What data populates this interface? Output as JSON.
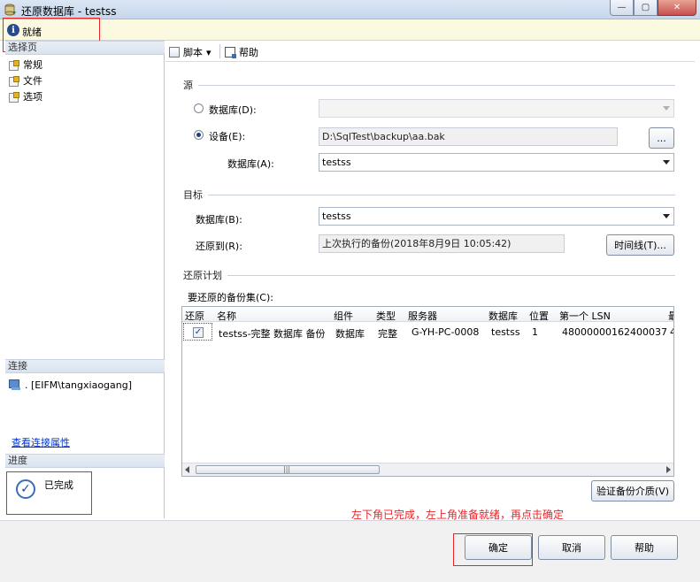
{
  "window": {
    "title": "还原数据库 - testss",
    "minimize_label": "—",
    "maximize_label": "▢",
    "close_label": "✕"
  },
  "status": {
    "text": "就绪"
  },
  "sidebar": {
    "select_page_header": "选择页",
    "pages": [
      {
        "label": "常规"
      },
      {
        "label": "文件"
      },
      {
        "label": "选项"
      }
    ],
    "connection_header": "连接",
    "connection": ". [EIFM\\tangxiaogang]",
    "connection_link": "查看连接属性",
    "progress_header": "进度",
    "progress_text": "已完成"
  },
  "toolbar": {
    "script_label": "脚本",
    "script_arrow": "▾",
    "help_label": "帮助"
  },
  "source": {
    "group_label": "源",
    "database_radio_label": "数据库(D):",
    "device_radio_label": "设备(E):",
    "device_value": "D:\\SqlTest\\backup\\aa.bak",
    "browse_button": "...",
    "database_label": "数据库(A):",
    "database_value": "testss"
  },
  "target": {
    "group_label": "目标",
    "database_label": "数据库(B):",
    "database_value": "testss",
    "restore_to_label": "还原到(R):",
    "restore_to_value": "上次执行的备份(2018年8月9日 10:05:42)",
    "timeline_button": "时间线(T)..."
  },
  "plan": {
    "group_label": "还原计划",
    "backup_sets_label": "要还原的备份集(C):",
    "columns": [
      "还原",
      "名称",
      "组件",
      "类型",
      "服务器",
      "数据库",
      "位置",
      "第一个 LSN",
      "最"
    ],
    "rows": [
      {
        "restore": true,
        "name": "testss-完整 数据库 备份",
        "component": "数据库",
        "type": "完整",
        "server": "G-YH-PC-0008",
        "database": "testss",
        "position": "1",
        "first_lsn": "48000000162400037",
        "last_lsn": "4"
      }
    ],
    "scroll_grip": "|||",
    "verify_button": "验证备份介质(V)"
  },
  "annotation": "左下角已完成，左上角准备就绪，再点击确定",
  "buttons": {
    "ok": "确定",
    "cancel": "取消",
    "help": "帮助"
  },
  "colors": {
    "annotation": "#e5262a",
    "status_bg": "#fbfae0",
    "link": "#0033cc"
  }
}
